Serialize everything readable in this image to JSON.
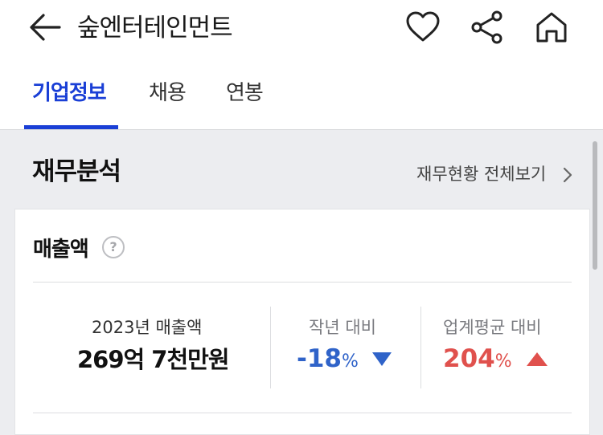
{
  "header": {
    "title": "숲엔터테인먼트",
    "icons": [
      "back-arrow-icon",
      "heart-icon",
      "share-icon",
      "home-icon"
    ]
  },
  "tabs": [
    {
      "label": "기업정보",
      "active": true
    },
    {
      "label": "채용",
      "active": false
    },
    {
      "label": "연봉",
      "active": false
    }
  ],
  "section": {
    "title": "재무분석",
    "view_all": "재무현황 전체보기"
  },
  "revenue_card": {
    "title": "매출액",
    "help": "?",
    "year_label": "2023년 매출액",
    "value": "269억 7천만원",
    "yoy": {
      "label": "작년 대비",
      "value": "-18",
      "unit": "%",
      "direction": "down",
      "color": "#2f63c9"
    },
    "industry": {
      "label": "업계평균 대비",
      "value": "204",
      "unit": "%",
      "direction": "up",
      "color": "#e0514d"
    }
  },
  "colors": {
    "accent": "#1a3fd6",
    "background": "#ecedf0"
  }
}
